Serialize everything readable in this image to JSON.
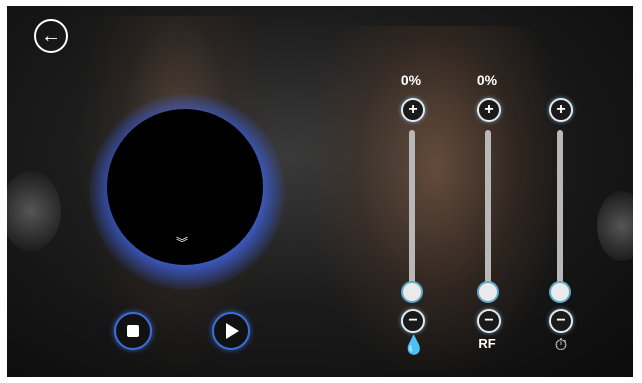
{
  "header": {
    "back_icon": "arrow-left-icon",
    "back_glyph": "←"
  },
  "session": {
    "stop_icon": "stop-icon",
    "play_icon": "play-icon",
    "orb_indicator": "︾"
  },
  "channels": [
    {
      "id": "hydro",
      "percent": "0%",
      "level": 0,
      "label": "",
      "icon": "water-drop-icon",
      "icon_glyph": "💧",
      "plus": "+",
      "minus": "−"
    },
    {
      "id": "rf",
      "percent": "0%",
      "level": 0,
      "label": "RF",
      "icon": "",
      "icon_glyph": "",
      "plus": "+",
      "minus": "−"
    },
    {
      "id": "timer",
      "percent": "",
      "level": 0,
      "label": "",
      "icon": "timer-icon",
      "icon_glyph": "⏱",
      "plus": "+",
      "minus": "−"
    }
  ],
  "colors": {
    "accent_glow": "#4a78ff",
    "knob_ring": "#5fa8c8"
  }
}
